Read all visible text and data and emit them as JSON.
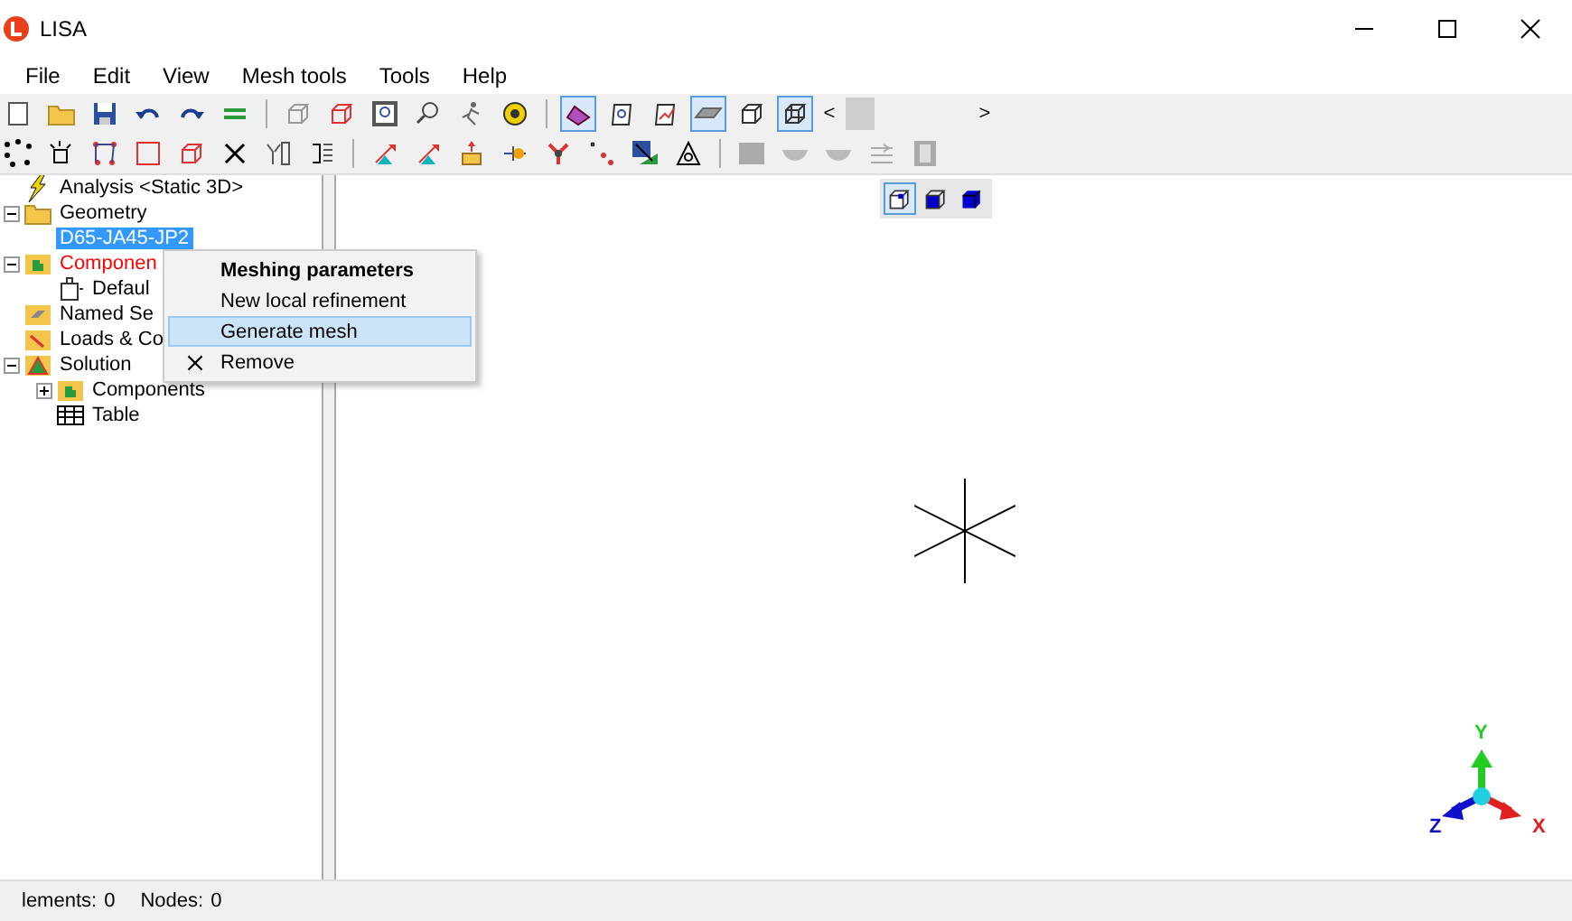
{
  "window": {
    "title": "LISA"
  },
  "menu_bar": [
    "File",
    "Edit",
    "View",
    "Mesh tools",
    "Tools",
    "Help"
  ],
  "toolbar_1": [
    {
      "kind": "page",
      "pressed": false
    },
    {
      "kind": "folder",
      "pressed": false
    },
    {
      "kind": "floppy",
      "pressed": false
    },
    {
      "kind": "undo",
      "pressed": false
    },
    {
      "kind": "redo",
      "pressed": false
    },
    {
      "kind": "bars",
      "pressed": false
    },
    {
      "kind": "separator"
    },
    {
      "kind": "cube-grey",
      "pressed": false
    },
    {
      "kind": "cube-red",
      "pressed": false
    },
    {
      "kind": "frame",
      "pressed": false
    },
    {
      "kind": "magnifier",
      "pressed": false
    },
    {
      "kind": "runner",
      "pressed": false
    },
    {
      "kind": "tape",
      "pressed": false
    },
    {
      "kind": "separator"
    },
    {
      "kind": "shape",
      "pressed": true
    },
    {
      "kind": "question",
      "pressed": false
    },
    {
      "kind": "chart",
      "pressed": false
    },
    {
      "kind": "slab",
      "pressed": true
    },
    {
      "kind": "cube-outline",
      "pressed": false
    },
    {
      "kind": "cube-wire",
      "pressed": true
    }
  ],
  "toolbar_1_scroll": {
    "left": "<",
    "right": ">"
  },
  "toolbar_2": [
    {
      "kind": "dots",
      "pressed": false
    },
    {
      "kind": "box-dots",
      "pressed": false
    },
    {
      "kind": "nodes",
      "pressed": false
    },
    {
      "kind": "square",
      "pressed": false
    },
    {
      "kind": "cube-red",
      "pressed": false
    },
    {
      "kind": "cross",
      "pressed": false
    },
    {
      "kind": "split",
      "pressed": false
    },
    {
      "kind": "list",
      "pressed": false
    },
    {
      "kind": "separator"
    },
    {
      "kind": "tri-arrow",
      "pressed": false
    },
    {
      "kind": "tri-arrow",
      "pressed": false
    },
    {
      "kind": "box-arrow",
      "pressed": false
    },
    {
      "kind": "pin",
      "pressed": false
    },
    {
      "kind": "fork",
      "pressed": false
    },
    {
      "kind": "dots-red",
      "pressed": false
    },
    {
      "kind": "map",
      "pressed": false
    },
    {
      "kind": "triangle",
      "pressed": false
    },
    {
      "kind": "separator"
    },
    {
      "kind": "bar-grey",
      "pressed": false
    },
    {
      "kind": "bowl",
      "pressed": false
    },
    {
      "kind": "bowl",
      "pressed": false
    },
    {
      "kind": "lines",
      "pressed": false
    },
    {
      "kind": "film",
      "pressed": false
    }
  ],
  "tree": [
    {
      "label": "Analysis <Static 3D>",
      "kind": "analysis",
      "selected": false,
      "color": "#000000"
    },
    {
      "label": "Geometry",
      "kind": "folder",
      "expanded": true,
      "selected": false,
      "color": "#000000",
      "children": [
        {
          "label": "D65-JA45-JP2",
          "kind": "file",
          "selected": true
        }
      ]
    },
    {
      "label": "Componen",
      "kind": "components",
      "expanded": true,
      "selected": false,
      "color": "#ff0000",
      "children": [
        {
          "label": "Defaul",
          "kind": "component",
          "selected": false,
          "color": "#000000"
        }
      ]
    },
    {
      "label": "Named Se",
      "kind": "named",
      "selected": false,
      "color": "#000000"
    },
    {
      "label": "Loads & Co",
      "kind": "loads",
      "selected": false,
      "color": "#000000"
    },
    {
      "label": "Solution",
      "kind": "solution",
      "expanded": true,
      "selected": false,
      "color": "#000000",
      "children": [
        {
          "label": "Components",
          "kind": "components",
          "expanded": false,
          "selected": false,
          "color": "#000000"
        },
        {
          "label": "Table",
          "kind": "table",
          "selected": false,
          "color": "#000000"
        }
      ]
    }
  ],
  "context_menu": [
    {
      "label": "Meshing parameters",
      "kind": "default",
      "selected": false
    },
    {
      "label": "New local refinement",
      "kind": "plain",
      "selected": false
    },
    {
      "label": "Generate mesh",
      "kind": "plain",
      "selected": true
    },
    {
      "label": "Remove",
      "kind": "delete",
      "selected": false
    }
  ],
  "view_buttons": [
    {
      "kind": "cube-wire-blue",
      "pressed": true
    },
    {
      "kind": "cube-half-blue",
      "pressed": false
    },
    {
      "kind": "cube-solid-blue",
      "pressed": false
    }
  ],
  "axes": {
    "x": "X",
    "y": "Y",
    "z": "Z"
  },
  "status_bar": [
    {
      "label": "lements:",
      "value": "0"
    },
    {
      "label": "Nodes:",
      "value": "0"
    }
  ]
}
